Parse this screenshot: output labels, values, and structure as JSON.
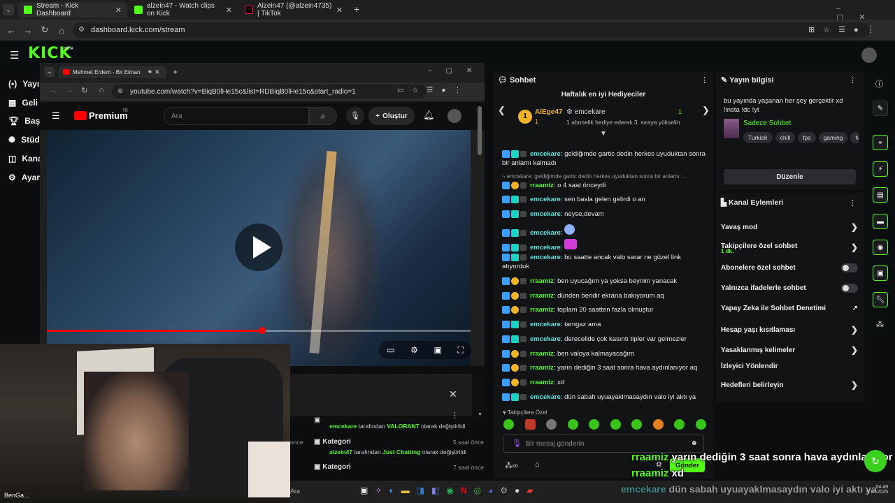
{
  "browser": {
    "tabs": [
      {
        "title": "Stream - Kick Dashboard",
        "active": true
      },
      {
        "title": "alzein47 - Watch clips on Kick",
        "active": false
      },
      {
        "title": "Alzein47 (@alzein4735) | TikTok",
        "active": false
      }
    ],
    "url": "dashboard.kick.com/stream"
  },
  "kick": {
    "logo": "KICK",
    "beta": "BETA",
    "left_nav": [
      "Yayı",
      "Geli",
      "Başa",
      "Stüd",
      "Kana",
      "Ayar"
    ]
  },
  "popup": {
    "tab_title": "Mehmet Erdem - Bir Elman",
    "url": "youtube.com/watch?v=BiqB0lHe15c&list=RDBiqB0lHe15c&start_radio=1",
    "yt_logo": "Premium",
    "yt_region": "TR",
    "search_placeholder": "Ara",
    "create_label": "Oluştur"
  },
  "chat": {
    "header": "Sohbet",
    "top_gifters_title": "Haftalık en iyi Hediyeciler",
    "gifter_rank": "1",
    "gifter_name": "AlEge47",
    "gifter_count": "1",
    "gifter_rank2": "1",
    "gifter_name2": "emcekare",
    "gifter_count2": "1",
    "gifter_note": "1 abonelik hediye ederek 3. sıraya yükselin",
    "reply_preview": "emcekare: geldiğimde gartic dedin herkes uyuduktan sonra bir anlamı ...",
    "messages": [
      {
        "user": "emcekare",
        "sep": ": ",
        "text": "geldiğimde gartic dedin herkes uyuduktan sonra bir anlamı kalmadı"
      },
      {
        "user": "rraamiz",
        "sep": ": ",
        "text": "o 4 saat önceydi"
      },
      {
        "user": "emcekare",
        "sep": ": ",
        "text": "sen basla gelen gelirdi o an"
      },
      {
        "user": "emcekare",
        "sep": ": ",
        "text": "neyse,devam"
      },
      {
        "user": "emcekare",
        "sep": ": ",
        "text": ""
      },
      {
        "user": "emcekare",
        "sep": ": ",
        "text": ""
      },
      {
        "user": "emcekare",
        "sep": ": ",
        "text": "bu saatte ancak valo sarar ne güzel link atıyorduk"
      },
      {
        "user": "rraamiz",
        "sep": ": ",
        "text": "ben uyucağım ya yoksa beynim yanacak"
      },
      {
        "user": "rraamiz",
        "sep": ": ",
        "text": "dünden beridir ekrana bakıyorum aq"
      },
      {
        "user": "rraamiz",
        "sep": ": ",
        "text": "toplam 20 saatten fazla olmuştur"
      },
      {
        "user": "emcekare",
        "sep": ": ",
        "text": "tamgaz ama"
      },
      {
        "user": "emcekare",
        "sep": ": ",
        "text": "derecelide çok kasıntı tipler var gelmezler"
      },
      {
        "user": "rraamiz",
        "sep": ": ",
        "text": "ben valoya kalmayacağım"
      },
      {
        "user": "rraamiz",
        "sep": ": ",
        "text": "yarın dediğin 3 saat sonra hava aydınlanıyor aq"
      },
      {
        "user": "rraamiz",
        "sep": ": ",
        "text": "xd"
      },
      {
        "user": "emcekare",
        "sep": ": ",
        "text": "dün sabah uyuayaklmasaydın valo iyi aktı ya"
      }
    ],
    "followers_only": "Takipçilere Özel",
    "input_placeholder": "Bir mesaj gönderin",
    "send_label": "Gönder"
  },
  "info": {
    "title": "Yayın bilgisi",
    "stream_title": "bu yayında yaşanan her şey gerçektir xd !insta !dc !yt",
    "category": "Sadece Sohbet",
    "tags": [
      "Turkish",
      "chill",
      "fps",
      "gaming",
      "fu"
    ],
    "edit_label": "Düzenle"
  },
  "actions": {
    "title": "Kanal Eylemleri",
    "items": [
      {
        "label": "Yavaş mod",
        "sub": ""
      },
      {
        "label": "Takipçilere özel sohbet",
        "sub": "1 dk."
      },
      {
        "label": "Abonelere özel sohbet",
        "sub": ""
      },
      {
        "label": "Yalnızca ifadelerle sohbet",
        "sub": ""
      },
      {
        "label": "Yapay Zeka ile Sohbet Denetimi",
        "sub": ""
      },
      {
        "label": "Hesap yaşı kısıtlaması",
        "sub": ""
      },
      {
        "label": "Yasaklanmış kelimeler",
        "sub": ""
      },
      {
        "label": "İzleyici Yönlendir",
        "sub": ""
      },
      {
        "label": "Hedefleri belirleyin",
        "sub": ""
      }
    ]
  },
  "activity": [
    {
      "title": "",
      "by": "emcekare",
      "mid": " tarafından ",
      "cat": "VALORANT",
      "end": " olarak değiştirildi",
      "time": "once"
    },
    {
      "title": "Kategori",
      "by": "alzein47",
      "mid": " tarafından ",
      "cat": "Just Chatting",
      "end": " olarak değiştirildi",
      "time": "5 saat önce"
    },
    {
      "title": "Kategori",
      "by": "",
      "mid": "",
      "cat": "",
      "end": "",
      "time": "7 saat önce"
    }
  ],
  "overlay": {
    "line1_user": "rraamiz",
    "line1_text": "yarın dediğin 3 saat sonra hava aydınlanıyor aq",
    "line2_user": "rraamiz",
    "line2_text": "xd",
    "line3_user": "emcekare",
    "line3_text": "dün sabah uyuayaklmasaydın valo iyi aktı ya",
    "webcam_name": "BenGa..."
  },
  "taskbar": {
    "search": "Ara",
    "time": "04:49",
    "date": "5.10.2025"
  },
  "colors": {
    "kick_green": "#53fc18",
    "emcekare": "#5be3e0",
    "rraamiz": "#53fc18"
  }
}
